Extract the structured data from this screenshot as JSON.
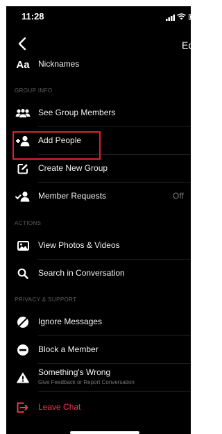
{
  "status": {
    "time": "11:28"
  },
  "nav": {
    "edit_label": "Edit"
  },
  "sections": {
    "group_info": "GROUP INFO",
    "actions": "ACTIONS",
    "privacy": "PRIVACY & SUPPORT"
  },
  "rows": {
    "nicknames": "Nicknames",
    "see_members": "See Group Members",
    "add_people": "Add People",
    "create_group": "Create New Group",
    "member_requests": "Member Requests",
    "member_requests_value": "Off",
    "view_photos": "View Photos & Videos",
    "search": "Search in Conversation",
    "ignore": "Ignore Messages",
    "block": "Block a Member",
    "wrong": "Something's Wrong",
    "wrong_sub": "Give Feedback or Report Conversation",
    "leave": "Leave Chat"
  },
  "icons": {
    "nicknames": "Aa",
    "leave_color": "#f23a52",
    "highlight_color": "#e0212b"
  }
}
